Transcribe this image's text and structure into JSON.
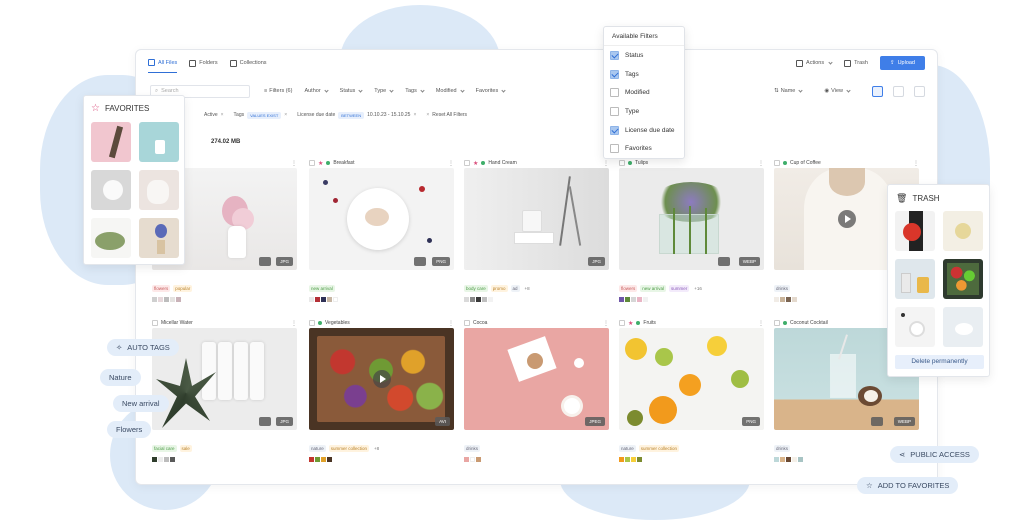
{
  "topbar": {
    "tabs": [
      {
        "label": "All Files",
        "icon": "image-icon"
      },
      {
        "label": "Folders",
        "icon": "folder-icon"
      },
      {
        "label": "Collections",
        "icon": "bookmark-icon"
      }
    ],
    "actions_label": "Actions",
    "trash_label": "Trash",
    "upload_label": "Upload"
  },
  "filters": {
    "search_placeholder": "Search",
    "filters_label": "Filters (6)",
    "items": [
      "Author",
      "Status",
      "Type",
      "Tags",
      "Modified",
      "Favorites"
    ],
    "sort_label": "Name",
    "view_label": "View"
  },
  "active_filters": {
    "status_value": "Active",
    "tags_label": "Tags",
    "tags_value": "VALUES EXIST",
    "license_label": "License due date",
    "between_label": "BETWEEN",
    "date_range": "10.10.23 - 15.10.25",
    "reset_label": "Reset All Filters"
  },
  "summary": {
    "size": "274.02 MB"
  },
  "dropdown": {
    "title": "Available Filters",
    "items": [
      {
        "label": "Status",
        "checked": true
      },
      {
        "label": "Tags",
        "checked": true
      },
      {
        "label": "Modified",
        "checked": false
      },
      {
        "label": "Type",
        "checked": false
      },
      {
        "label": "License due date",
        "checked": true
      },
      {
        "label": "Favorites",
        "checked": false
      }
    ]
  },
  "cards": [
    {
      "name": "Breakfast",
      "badge": "PNG",
      "status_color": "#3fae6a",
      "fav": true,
      "tags": [
        "new arrival"
      ]
    },
    {
      "name": "Hand Cream",
      "badge": "JPG",
      "status_color": "#3fae6a",
      "fav": true,
      "tags": [
        "body care",
        "promo",
        "ad",
        "+8"
      ]
    },
    {
      "name": "Tulips",
      "badge": "WEBP",
      "status_color": "#3fae6a",
      "fav": false,
      "tags": [
        "flowers",
        "new arrival",
        "summer",
        "+16"
      ]
    },
    {
      "name": "Cup of Coffee",
      "badge": "",
      "status_color": "#3fae6a",
      "fav": false,
      "tags": [
        "drinks"
      ]
    },
    {
      "name": "Micellar Water",
      "badge": "JPG",
      "status_color": "",
      "fav": false,
      "tags": [
        "facial care",
        "sale"
      ]
    },
    {
      "name": "Vegetables",
      "badge": "AVI",
      "status_color": "#3fae6a",
      "fav": false,
      "tags": [
        "nature",
        "summer collection",
        "+8"
      ]
    },
    {
      "name": "Cocoa",
      "badge": "JPEG",
      "status_color": "",
      "fav": false,
      "tags": [
        "drinks"
      ]
    },
    {
      "name": "Fruits",
      "badge": "PNG",
      "status_color": "#3fae6a",
      "fav": true,
      "tags": [
        "nature",
        "summer collection"
      ]
    },
    {
      "name": "Coconut Cocktail",
      "badge": "WEBP",
      "status_color": "#3fae6a",
      "fav": false,
      "tags": [
        "drinks"
      ]
    }
  ],
  "first_card_tags": [
    "flowers",
    "popular"
  ],
  "first_card_badge": "JPG",
  "favorites_panel": {
    "title": "FAVORITES"
  },
  "trash_panel": {
    "title": "TRASH",
    "delete_label": "Delete permanently"
  },
  "pills": {
    "auto_tags": "AUTO TAGS",
    "nature": "Nature",
    "new_arrival": "New arrival",
    "flowers": "Flowers",
    "public_access": "PUBLIC ACCESS",
    "add_to_favorites": "ADD TO FAVORITES"
  }
}
